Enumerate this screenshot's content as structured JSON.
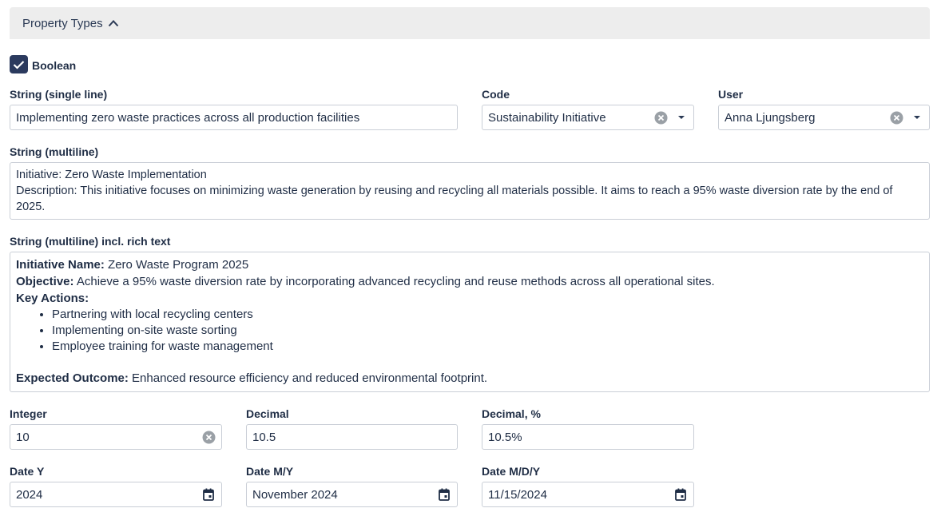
{
  "section": {
    "title": "Property Types"
  },
  "boolean": {
    "label": "Boolean",
    "checked": true
  },
  "string_single": {
    "label": "String (single line)",
    "value": "Implementing zero waste practices across all production facilities"
  },
  "code": {
    "label": "Code",
    "value": "Sustainability Initiative"
  },
  "user": {
    "label": "User",
    "value": "Anna Ljungsberg"
  },
  "string_multi": {
    "label": "String (multiline)",
    "line1": "Initiative: Zero Waste Implementation",
    "line2": "Description: This initiative focuses on minimizing waste generation by reusing and recycling all materials possible. It aims to reach a 95% waste diversion rate by the end of 2025."
  },
  "rich": {
    "label": "String (multiline) incl. rich text",
    "name_label": "Initiative Name:",
    "name_value": " Zero Waste Program 2025",
    "objective_label": "Objective:",
    "objective_value": " Achieve a 95% waste diversion rate by incorporating advanced recycling and reuse methods across all operational sites.",
    "actions_label": "Key Actions:",
    "actions": [
      "Partnering with local recycling centers",
      "Implementing on-site waste sorting",
      "Employee training for waste management"
    ],
    "outcome_label": "Expected Outcome:",
    "outcome_value": " Enhanced resource efficiency and reduced environmental footprint."
  },
  "integer": {
    "label": "Integer",
    "value": "10"
  },
  "decimal": {
    "label": "Decimal",
    "value": "10.5"
  },
  "decimal_pct": {
    "label": "Decimal, %",
    "value": "10.5%"
  },
  "date_y": {
    "label": "Date Y",
    "value": "2024"
  },
  "date_my": {
    "label": "Date M/Y",
    "value": "November 2024"
  },
  "date_mdy": {
    "label": "Date M/D/Y",
    "value": "11/15/2024"
  },
  "icons": {
    "chevron_up": "chevron-up-icon",
    "clear": "clear-circle-icon",
    "dropdown": "caret-down-icon",
    "calendar": "calendar-icon",
    "check": "check-icon"
  },
  "colors": {
    "accent": "#2b3a5e",
    "header_bg": "#ededed",
    "border": "#c9ced6",
    "text": "#1f2d45"
  }
}
